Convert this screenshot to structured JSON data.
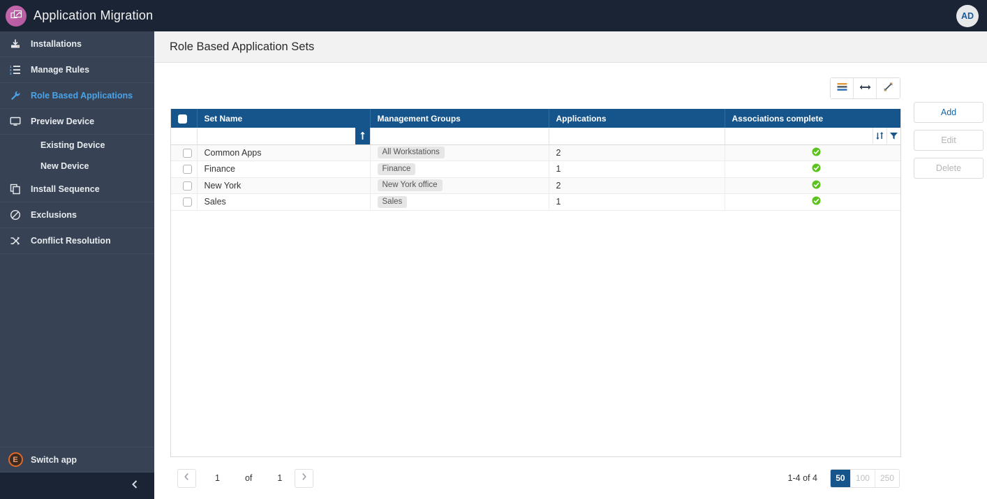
{
  "header": {
    "app_title": "Application Migration",
    "logo_icon": "windows-stack-icon",
    "avatar_initials": "AD"
  },
  "sidebar": {
    "items": [
      {
        "label": "Installations",
        "icon": "download-install-icon",
        "active": false,
        "sub": false
      },
      {
        "label": "Manage Rules",
        "icon": "numbered-list-icon",
        "active": false,
        "sub": false
      },
      {
        "label": "Role Based Applications",
        "icon": "wrench-icon",
        "active": true,
        "sub": false
      },
      {
        "label": "Preview Device",
        "icon": "monitor-icon",
        "active": false,
        "sub": false
      }
    ],
    "sub_items": [
      {
        "label": "Existing Device"
      },
      {
        "label": "New Device"
      }
    ],
    "items_lower": [
      {
        "label": "Install Sequence",
        "icon": "copy-stack-icon",
        "active": false
      },
      {
        "label": "Exclusions",
        "icon": "prohibition-icon",
        "active": false
      },
      {
        "label": "Conflict Resolution",
        "icon": "shuffle-arrows-icon",
        "active": false
      }
    ],
    "switch_app": {
      "label": "Switch app",
      "icon": "e-badge-icon"
    },
    "collapse_icon": "chevron-left-icon"
  },
  "page": {
    "title": "Role Based Application Sets"
  },
  "grid_toolbar": {
    "buttons": [
      {
        "name": "column-chooser-button",
        "icon": "list-lines-icon"
      },
      {
        "name": "fit-width-button",
        "icon": "horizontal-resize-icon"
      },
      {
        "name": "fullscreen-button",
        "icon": "diagonal-expand-icon"
      }
    ]
  },
  "table": {
    "columns": [
      "Set Name",
      "Management Groups",
      "Applications",
      "Associations complete"
    ],
    "sort_column": "Set Name",
    "sort_direction": "ascending",
    "filter_icons": [
      "sort-icon",
      "filter-funnel-icon"
    ],
    "rows": [
      {
        "set_name": "Common Apps",
        "management_group": "All Workstations",
        "applications": "2",
        "associations_complete": true
      },
      {
        "set_name": "Finance",
        "management_group": "Finance",
        "applications": "1",
        "associations_complete": true
      },
      {
        "set_name": "New York",
        "management_group": "New York office",
        "applications": "2",
        "associations_complete": true
      },
      {
        "set_name": "Sales",
        "management_group": "Sales",
        "applications": "1",
        "associations_complete": true
      }
    ]
  },
  "actions": {
    "add": "Add",
    "edit": "Edit",
    "delete": "Delete"
  },
  "pagination": {
    "prev_icon": "chevron-left-icon",
    "next_icon": "chevron-right-icon",
    "current_page": "1",
    "of_label": "of",
    "total_pages": "1",
    "range_label": "1-4 of 4",
    "page_sizes": [
      "50",
      "100",
      "250"
    ],
    "selected_size": "50"
  },
  "colors": {
    "header_bg": "#1b2435",
    "sidebar_bg": "#374355",
    "accent_blue": "#15558c",
    "link_blue": "#1565a8",
    "active_nav": "#4aa3e8",
    "success_green": "#5cc21e"
  }
}
